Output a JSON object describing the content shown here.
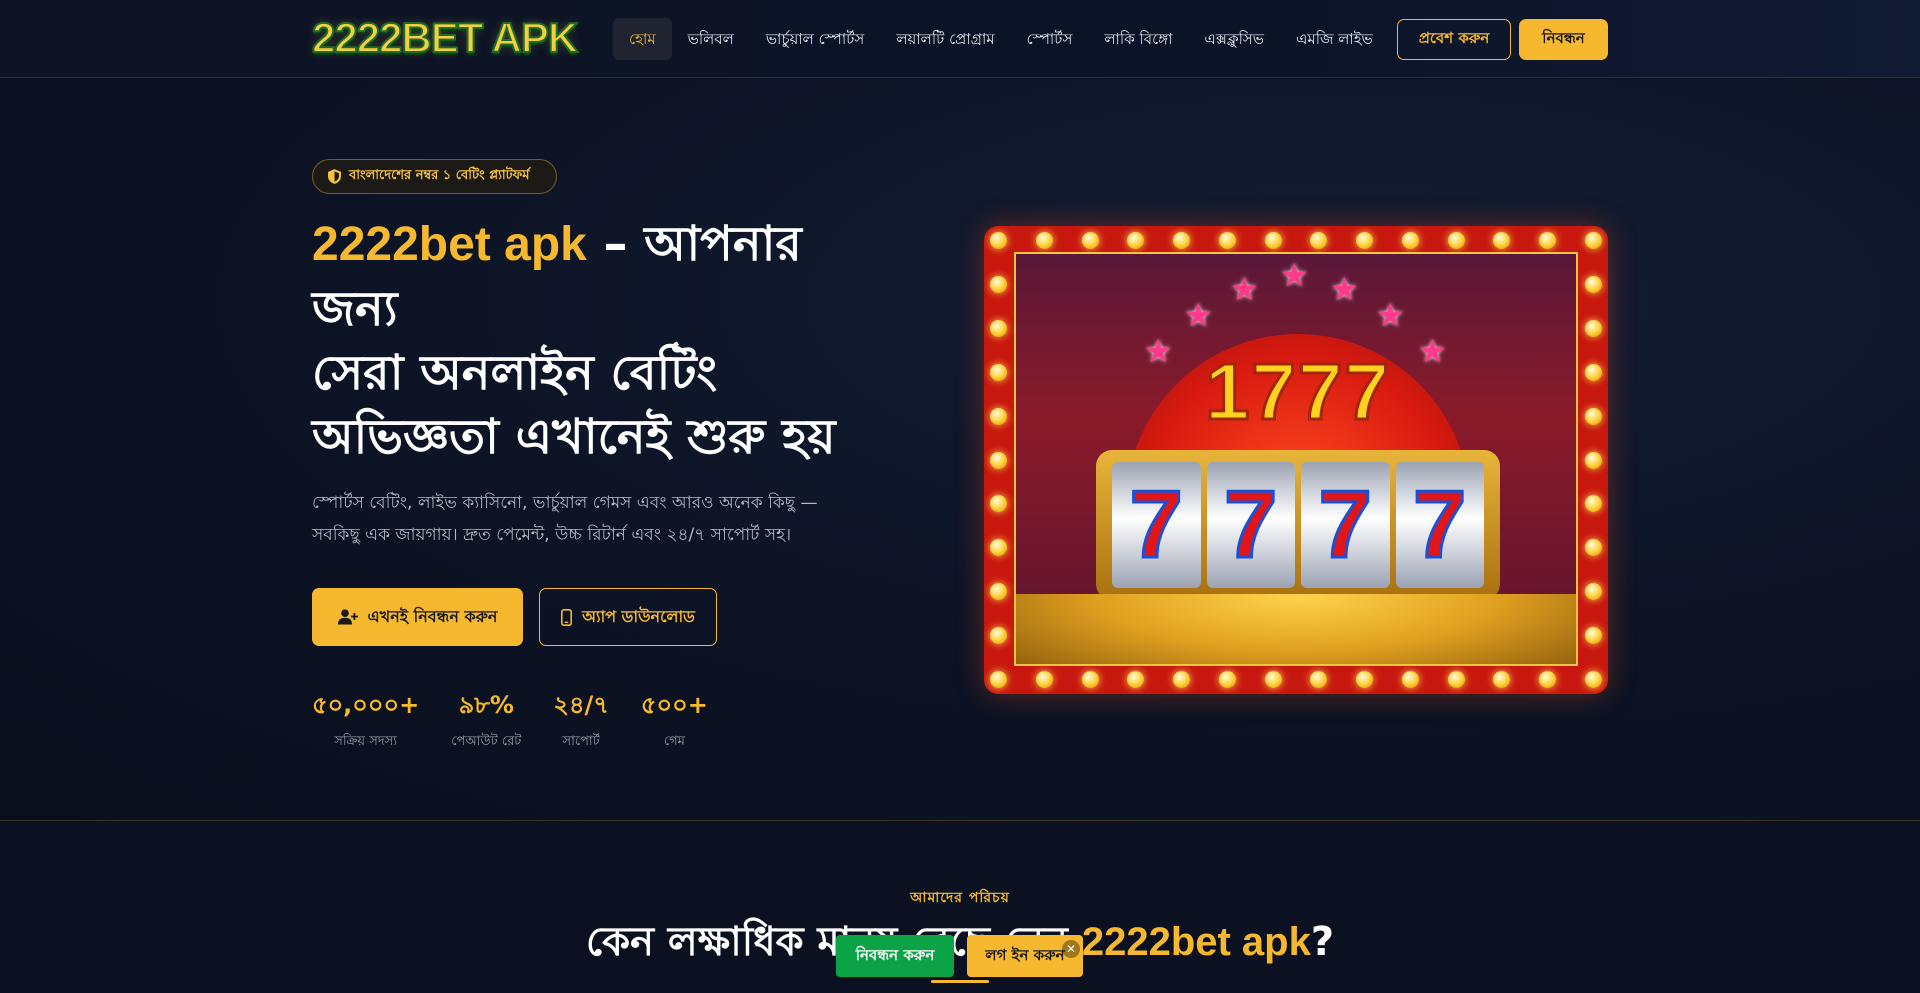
{
  "header": {
    "logo_text": "2222BET APK",
    "nav": [
      {
        "label": "হোম",
        "active": true
      },
      {
        "label": "ভলিবল",
        "active": false
      },
      {
        "label": "ভার্চুয়াল স্পোর্টস",
        "active": false
      },
      {
        "label": "লয়ালটি প্রোগ্রাম",
        "active": false
      },
      {
        "label": "স্পোর্টস",
        "active": false
      },
      {
        "label": "লাকি বিঙ্গো",
        "active": false
      },
      {
        "label": "এক্সক্লুসিভ",
        "active": false
      },
      {
        "label": "এমজি লাইভ",
        "active": false
      }
    ],
    "login_label": "প্রবেশ করুন",
    "register_label": "নিবন্ধন"
  },
  "hero": {
    "badge": "বাংলাদেশের নম্বর ১ বেটিং প্ল্যাটফর্ম",
    "headline_accent": "2222bet apk",
    "headline_rest_1": " – আপনার জন্য",
    "headline_rest_2": "সেরা অনলাইন বেটিং অভিজ্ঞতা এখানেই শুরু হয়",
    "lead": "স্পোর্টস বেটিং, লাইভ ক্যাসিনো, ভার্চুয়াল গেমস এবং আরও অনেক কিছু — সবকিছু এক জায়গায়। দ্রুত পেমেন্ট, উচ্চ রিটার্ন এবং ২৪/৭ সাপোর্ট সহ।",
    "cta_primary": "এখনই নিবন্ধন করুন",
    "cta_secondary": "অ্যাপ ডাউনলোড",
    "stats": [
      {
        "value": "৫০,০০০+",
        "label": "সক্রিয় সদস্য"
      },
      {
        "value": "৯৮%",
        "label": "পেআউট রেট"
      },
      {
        "value": "২৪/৭",
        "label": "সাপোর্ট"
      },
      {
        "value": "৫০০+",
        "label": "গেম"
      }
    ],
    "slot_image": {
      "title": "1777",
      "reels": [
        "7",
        "7",
        "7",
        "7"
      ]
    }
  },
  "about": {
    "kicker": "আমাদের পরিচয়",
    "title_prefix": "কেন লক্ষাধিক মানুষ বেছে নেন ",
    "title_accent": "2222bet apk",
    "title_suffix": "?"
  },
  "floating": {
    "register_label": "নিবন্ধন করুন",
    "login_label": "লগ ইন করুন",
    "close_glyph": "✕"
  },
  "colors": {
    "accent": "#f5b82e",
    "background": "#0b1120",
    "float_green": "#0ba346"
  }
}
